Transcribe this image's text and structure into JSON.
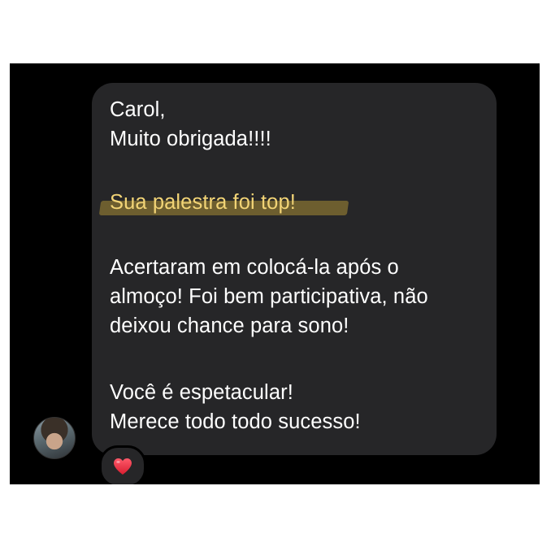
{
  "message": {
    "lines": [
      "Carol,",
      "Muito obrigada!!!!",
      "Sua palestra foi top!",
      "Acertaram em colocá-la após o",
      "almoço! Foi bem participativa, não",
      "deixou chance para sono!",
      "Você é espetacular!",
      "Merece todo todo sucesso!"
    ],
    "highlight_color": "#f2d476",
    "bubble_color": "#262628"
  },
  "reaction": {
    "icon": "red-heart-icon",
    "color": "#e5283a"
  },
  "avatar": {
    "icon": "profile-photo"
  }
}
